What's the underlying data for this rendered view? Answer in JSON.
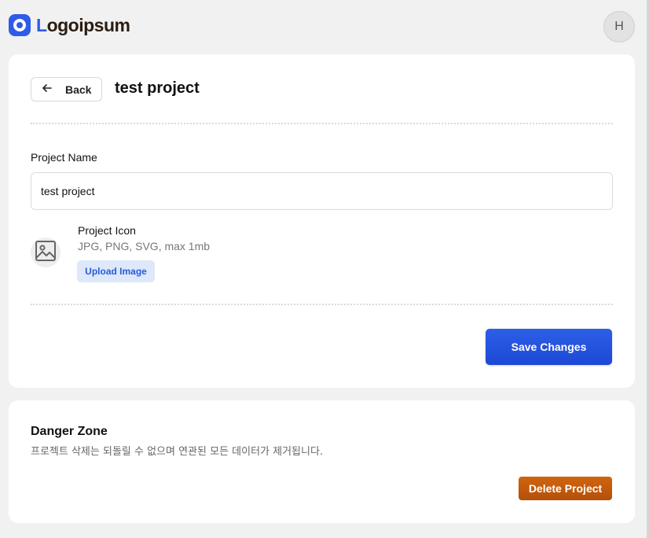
{
  "header": {
    "logo_prefix": "L",
    "logo_rest": "ogoipsum",
    "avatar_initial": "H"
  },
  "project": {
    "back_label": "Back",
    "title": "test project",
    "name_label": "Project Name",
    "name_value": "test project",
    "icon_title": "Project Icon",
    "icon_hint": "JPG, PNG, SVG, max 1mb",
    "upload_label": "Upload Image",
    "save_label": "Save Changes"
  },
  "danger": {
    "title": "Danger Zone",
    "description": "프로젝트 삭제는 되돌릴 수 없으며 연관된 모든 데이터가 제거됩니다.",
    "delete_label": "Delete Project"
  },
  "icons": {
    "back": "arrow-left-icon",
    "image_placeholder": "image-icon"
  },
  "colors": {
    "primary": "#2d5fe6",
    "danger": "#c85c0d",
    "upload_bg": "#dde8fb"
  }
}
